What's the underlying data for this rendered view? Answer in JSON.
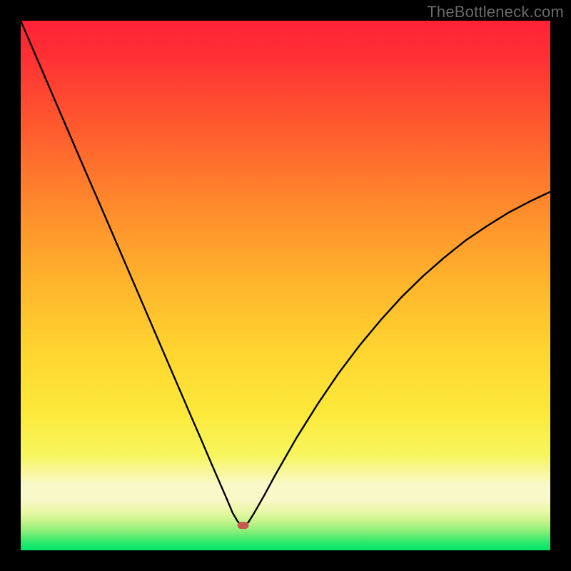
{
  "watermark": "TheBottleneck.com",
  "chart_data": {
    "type": "line",
    "title": "",
    "xlabel": "",
    "ylabel": "",
    "xlim": [
      0,
      100
    ],
    "ylim": [
      0,
      100
    ],
    "grid": false,
    "legend": false,
    "regions": {
      "top_color": "#ff2236",
      "bottom_color": "#00e66a",
      "mid_yellow": "#fce93a",
      "pale_band": "#f8f8c8"
    },
    "marker": {
      "x": 42,
      "y": 4.7,
      "color": "#c45a52"
    },
    "series": [
      {
        "name": "bottleneck-curve",
        "x": [
          0,
          4,
          8,
          12,
          16,
          20,
          24,
          28,
          32,
          34,
          36,
          38,
          39,
          40,
          41,
          42,
          43,
          44,
          46,
          48,
          52,
          56,
          60,
          64,
          68,
          72,
          76,
          80,
          84,
          88,
          92,
          96,
          100
        ],
        "y": [
          100,
          90.7,
          81.4,
          72.1,
          62.9,
          53.6,
          44.3,
          35.0,
          25.7,
          21.1,
          16.4,
          11.8,
          9.5,
          7.1,
          5.4,
          4.6,
          5.3,
          6.9,
          10.4,
          14.1,
          21.1,
          27.5,
          33.4,
          38.7,
          43.5,
          47.9,
          51.8,
          55.3,
          58.5,
          61.2,
          63.7,
          65.8,
          67.7
        ]
      }
    ]
  }
}
